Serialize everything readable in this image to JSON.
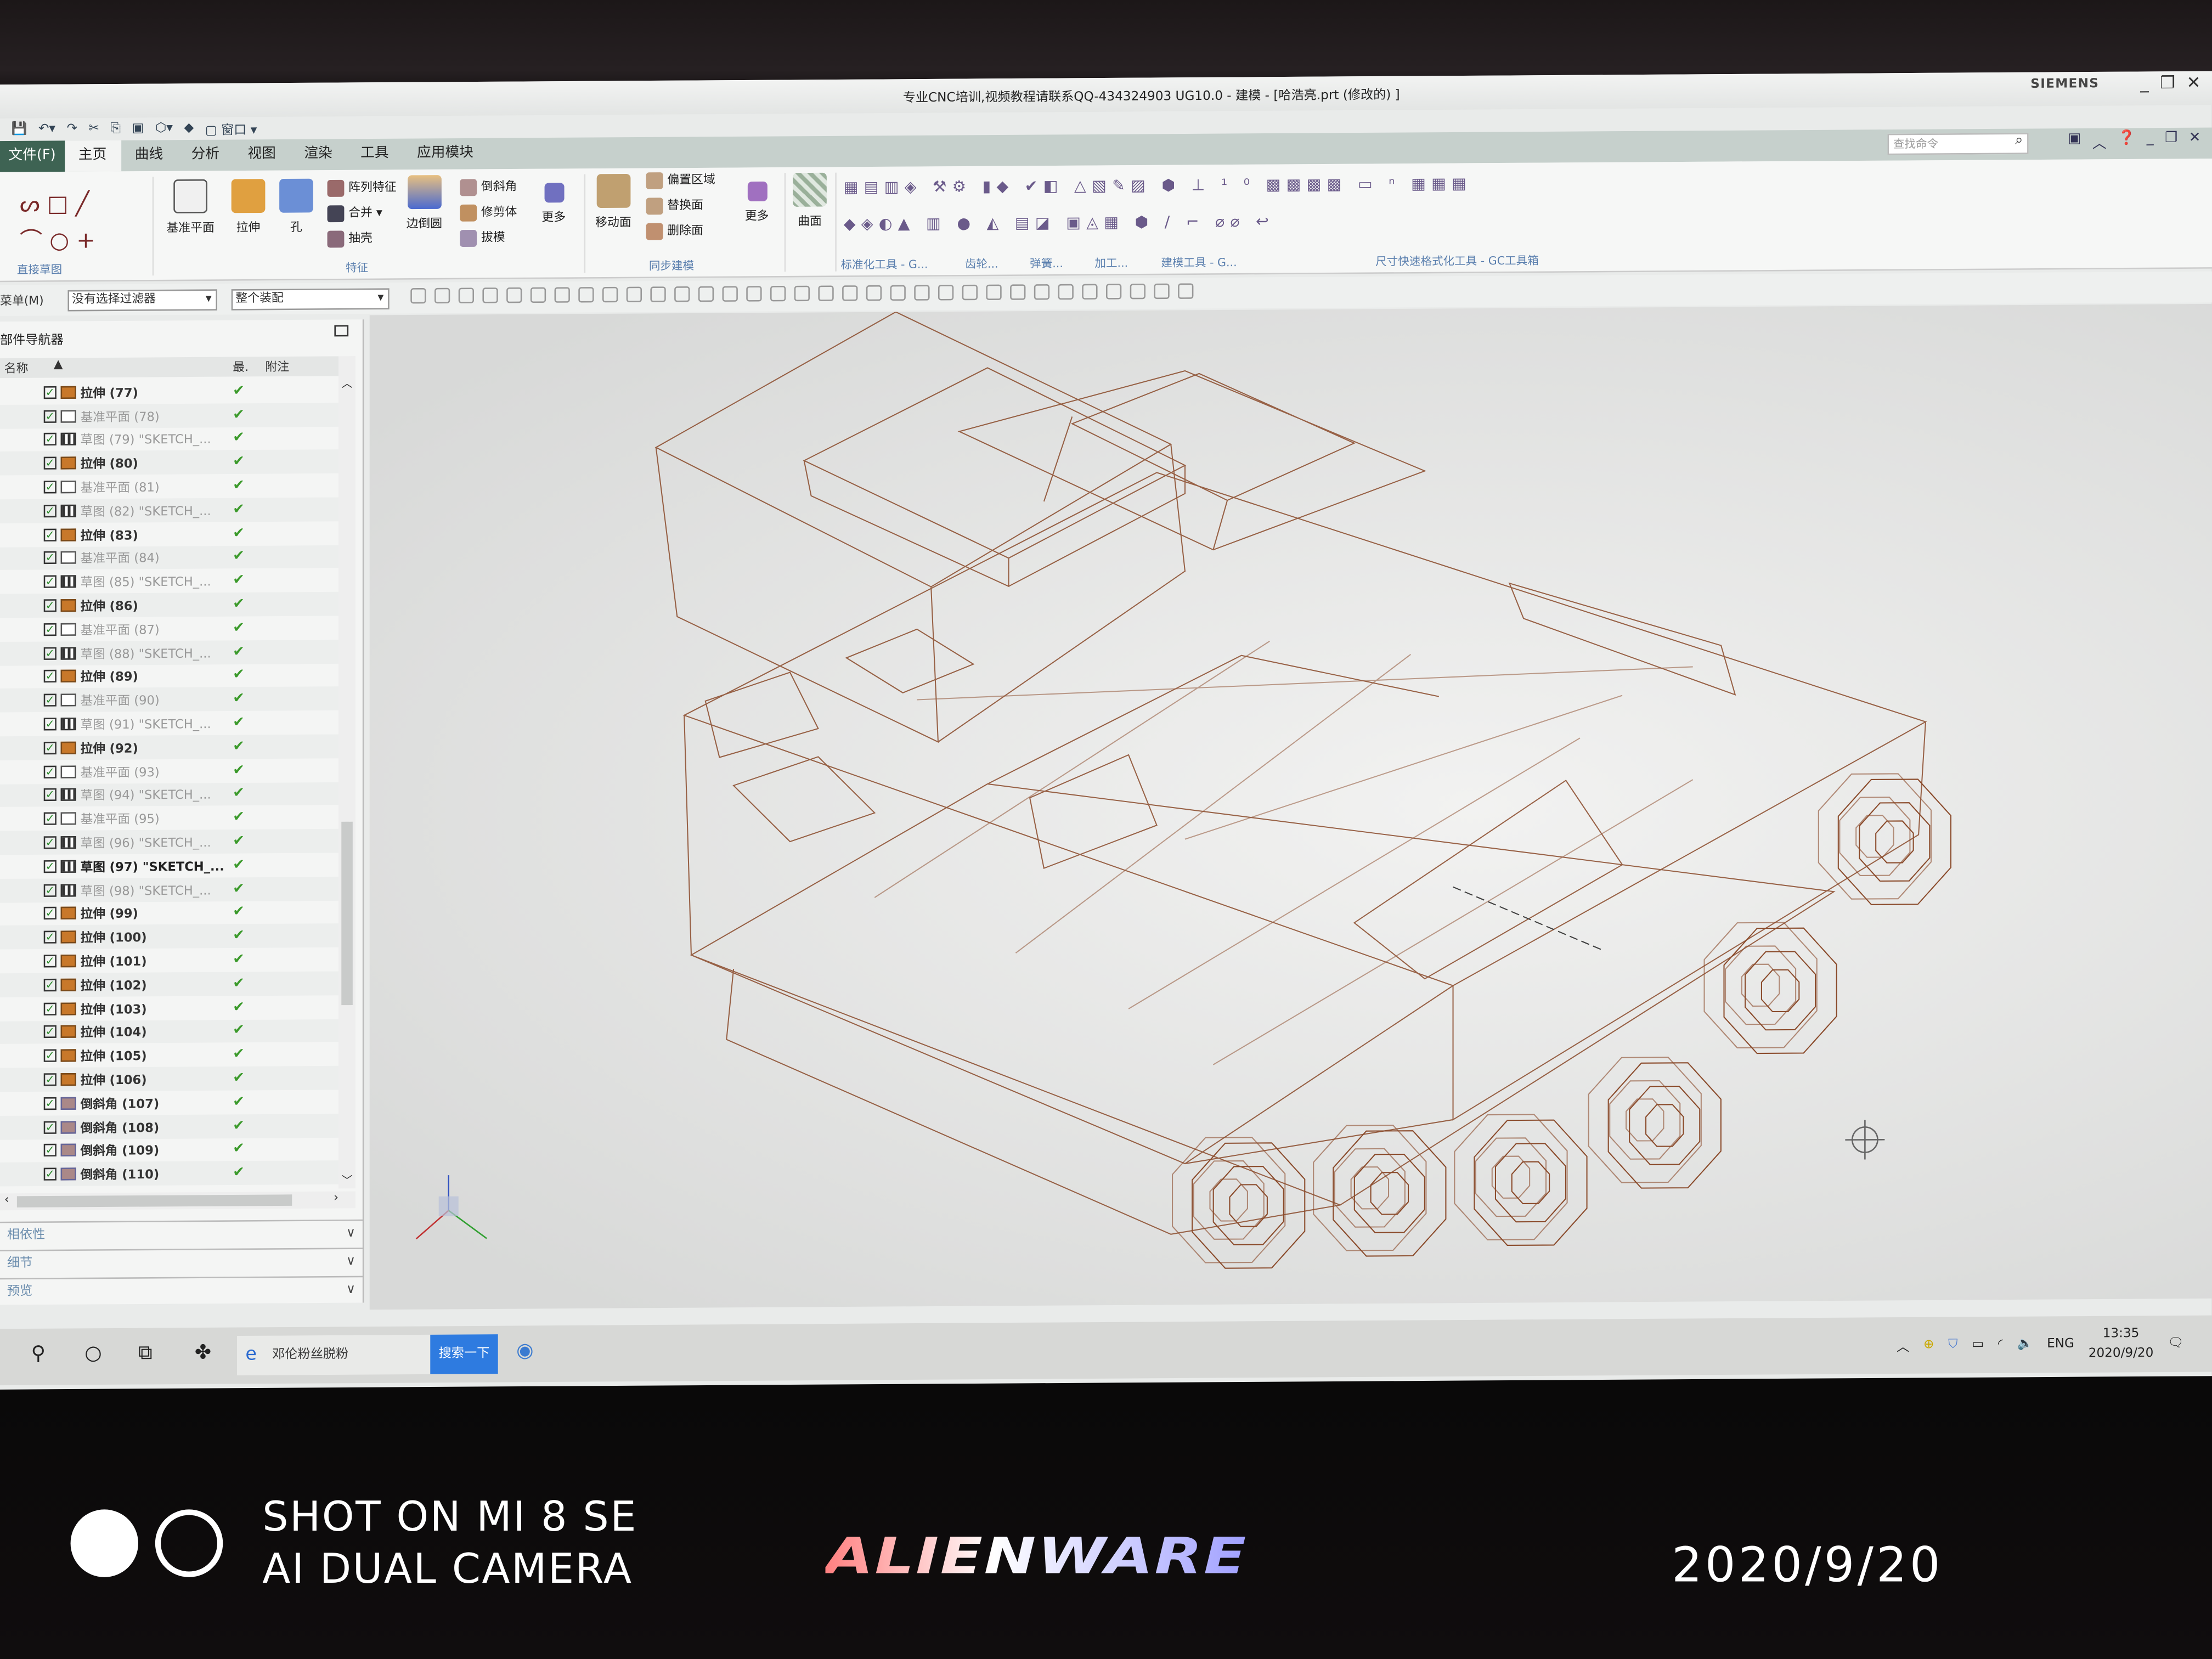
{
  "window": {
    "title": "专业CNC培训,视频教程请联系QQ-434324903 UG10.0 - 建模 - [哈浩亮.prt  (修改的) ]",
    "brand": "SIEMENS",
    "quick_access_window": "窗口"
  },
  "tabs": [
    {
      "label": "文件(F)"
    },
    {
      "label": "主页"
    },
    {
      "label": "曲线"
    },
    {
      "label": "分析"
    },
    {
      "label": "视图"
    },
    {
      "label": "渲染"
    },
    {
      "label": "工具"
    },
    {
      "label": "应用模块"
    }
  ],
  "search": {
    "placeholder": "查找命令"
  },
  "ribbon": {
    "buttons": {
      "datum_plane": "基准平面",
      "extrude": "拉伸",
      "hole": "孔",
      "pattern": "阵列特征",
      "unite": "合并",
      "shell": "抽壳",
      "edge_blend": "边倒圆",
      "chamfer": "倒斜角",
      "trim_body": "修剪体",
      "draft": "拔模",
      "more1": "更多",
      "move_face": "移动面",
      "offset_region": "偏置区域",
      "replace_face": "替换面",
      "delete_face": "删除面",
      "more2": "更多",
      "surface": "曲面"
    },
    "groups": {
      "sketch": "直接草图",
      "feature": "特征",
      "sync": "同步建模",
      "std": "标准化工具 - G...",
      "gear": "齿轮...",
      "spring": "弹簧...",
      "machining": "加工...",
      "modeling": "建模工具 - G...",
      "dim": "尺寸快速格式化工具 - GC工具箱"
    }
  },
  "toolbar": {
    "menu": "菜单(M)",
    "filter": "没有选择过滤器",
    "scope": "整个装配"
  },
  "navigator": {
    "title": "部件导航器",
    "columns": [
      "名称",
      "最.",
      "附注"
    ],
    "items": [
      {
        "type": "extrude",
        "label": "拉伸 (77)"
      },
      {
        "type": "datum",
        "label": "基准平面 (78)"
      },
      {
        "type": "sketch",
        "label": "草图 (79) \"SKETCH_..."
      },
      {
        "type": "extrude",
        "label": "拉伸 (80)"
      },
      {
        "type": "datum",
        "label": "基准平面 (81)"
      },
      {
        "type": "sketch",
        "label": "草图 (82) \"SKETCH_..."
      },
      {
        "type": "extrude",
        "label": "拉伸 (83)"
      },
      {
        "type": "datum",
        "label": "基准平面 (84)"
      },
      {
        "type": "sketch",
        "label": "草图 (85) \"SKETCH_..."
      },
      {
        "type": "extrude",
        "label": "拉伸 (86)"
      },
      {
        "type": "datum",
        "label": "基准平面 (87)"
      },
      {
        "type": "sketch",
        "label": "草图 (88) \"SKETCH_..."
      },
      {
        "type": "extrude",
        "label": "拉伸 (89)"
      },
      {
        "type": "datum",
        "label": "基准平面 (90)"
      },
      {
        "type": "sketch",
        "label": "草图 (91) \"SKETCH_..."
      },
      {
        "type": "extrude",
        "label": "拉伸 (92)"
      },
      {
        "type": "datum",
        "label": "基准平面 (93)"
      },
      {
        "type": "sketch",
        "label": "草图 (94) \"SKETCH_..."
      },
      {
        "type": "datum",
        "label": "基准平面 (95)"
      },
      {
        "type": "sketch",
        "label": "草图 (96) \"SKETCH_..."
      },
      {
        "type": "sketch-active",
        "label": "草图 (97) \"SKETCH_..."
      },
      {
        "type": "sketch",
        "label": "草图 (98) \"SKETCH_..."
      },
      {
        "type": "extrude",
        "label": "拉伸 (99)"
      },
      {
        "type": "extrude",
        "label": "拉伸 (100)"
      },
      {
        "type": "extrude",
        "label": "拉伸 (101)"
      },
      {
        "type": "extrude",
        "label": "拉伸 (102)"
      },
      {
        "type": "extrude",
        "label": "拉伸 (103)"
      },
      {
        "type": "extrude",
        "label": "拉伸 (104)"
      },
      {
        "type": "extrude",
        "label": "拉伸 (105)"
      },
      {
        "type": "extrude",
        "label": "拉伸 (106)"
      },
      {
        "type": "chamfer",
        "label": "倒斜角 (107)"
      },
      {
        "type": "chamfer",
        "label": "倒斜角 (108)"
      },
      {
        "type": "chamfer",
        "label": "倒斜角 (109)"
      },
      {
        "type": "chamfer",
        "label": "倒斜角 (110)"
      }
    ],
    "panels": [
      "相依性",
      "细节",
      "预览"
    ]
  },
  "taskbar": {
    "search_text": "邓伦粉丝脱粉",
    "search_button": "搜索一下",
    "lang": "ENG",
    "time": "13:35",
    "date": "2020/9/20"
  },
  "photo_watermark": {
    "line1": "SHOT ON MI 8 SE",
    "line2": "AI DUAL CAMERA",
    "logo": "ALIENWARE",
    "date": "2020/9/20"
  },
  "colors": {
    "wireframe": "#8a4a2a",
    "file_tab": "#3e6353",
    "check": "#3b9a2b",
    "search_button": "#2e7be0"
  }
}
